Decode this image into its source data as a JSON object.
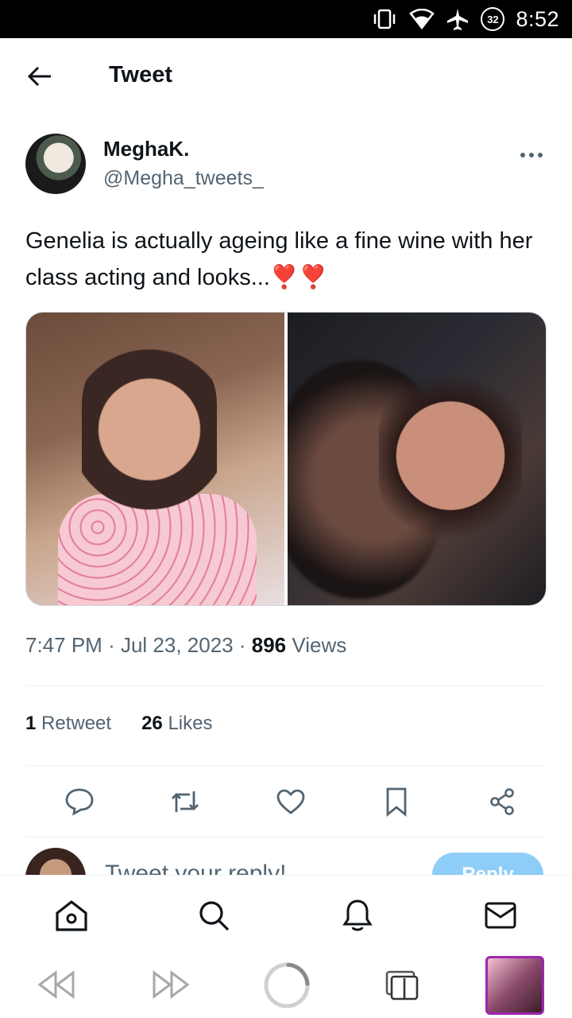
{
  "status_bar": {
    "time": "8:52",
    "battery": "32"
  },
  "header": {
    "title": "Tweet"
  },
  "tweet": {
    "author_name": "MeghaK.",
    "author_handle": "@Megha_tweets_",
    "text": "Genelia is actually ageing like a fine wine with her class acting and looks...",
    "emoji": "❣️❣️",
    "time": "7:47 PM",
    "date": "Jul 23, 2023",
    "views_count": "896",
    "views_label": "Views",
    "retweets_count": "1",
    "retweets_label": "Retweet",
    "likes_count": "26",
    "likes_label": "Likes"
  },
  "reply": {
    "placeholder": "Tweet your reply!",
    "button_label": "Reply"
  },
  "icons": {
    "back": "arrow-left-icon",
    "more": "more-horizontal-icon",
    "reply": "comment-icon",
    "retweet": "retweet-icon",
    "like": "heart-icon",
    "bookmark": "bookmark-icon",
    "share": "share-icon",
    "home": "home-icon",
    "search": "search-icon",
    "notifications": "bell-icon",
    "messages": "mail-icon"
  },
  "colors": {
    "accent": "#1d9bf0",
    "text": "#0f1419",
    "muted": "#536471",
    "reply_button": "#8ecdf8",
    "heart": "#e0245e"
  }
}
